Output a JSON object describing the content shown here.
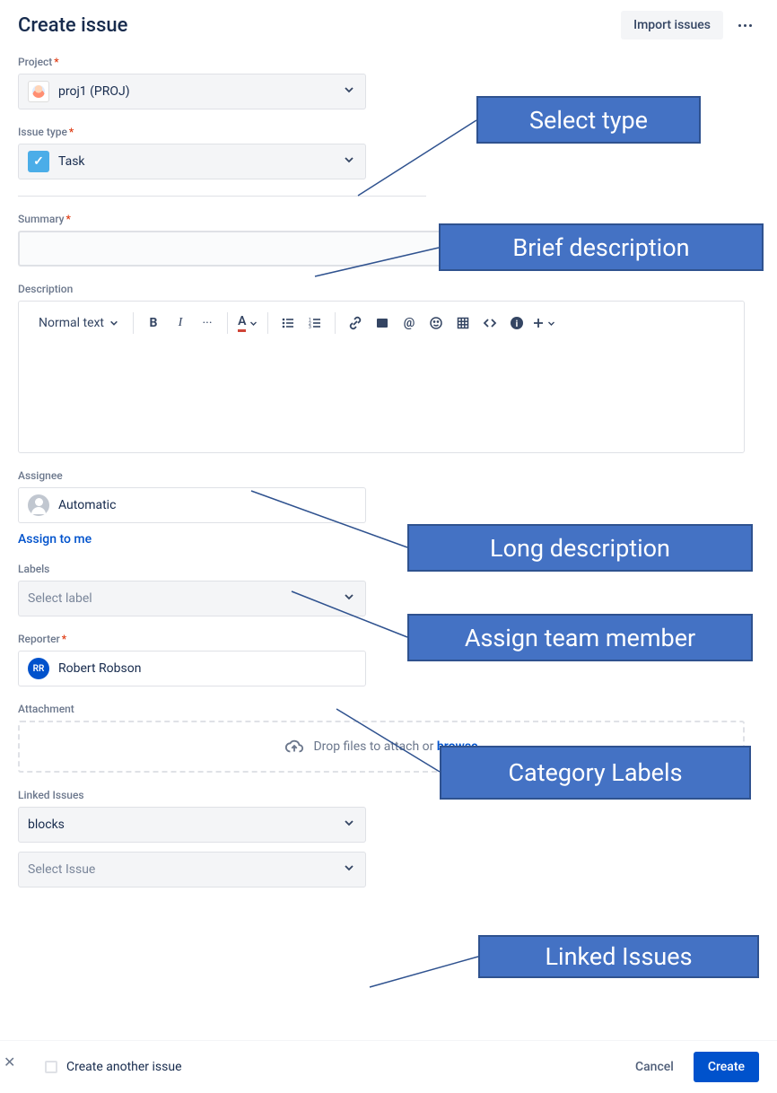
{
  "header": {
    "title": "Create issue",
    "import_label": "Import issues"
  },
  "fields": {
    "project": {
      "label": "Project",
      "value": "proj1 (PROJ)"
    },
    "issue_type": {
      "label": "Issue type",
      "value": "Task"
    },
    "summary": {
      "label": "Summary"
    },
    "description": {
      "label": "Description",
      "text_style": "Normal text"
    },
    "assignee": {
      "label": "Assignee",
      "value": "Automatic",
      "assign_me": "Assign to me"
    },
    "labels": {
      "label": "Labels",
      "placeholder": "Select label"
    },
    "reporter": {
      "label": "Reporter",
      "value": "Robert Robson",
      "initials": "RR"
    },
    "attachment": {
      "label": "Attachment",
      "drop_text": "Drop files to attach or ",
      "browse": "browse"
    },
    "linked": {
      "label": "Linked Issues",
      "relation": "blocks",
      "issue_placeholder": "Select Issue"
    }
  },
  "footer": {
    "create_another": "Create another issue",
    "cancel": "Cancel",
    "create": "Create"
  },
  "callouts": {
    "c1": "Select type",
    "c2": "Brief description",
    "c3": "Long description",
    "c4": "Assign team member",
    "c5": "Category Labels",
    "c6": "Linked Issues"
  }
}
